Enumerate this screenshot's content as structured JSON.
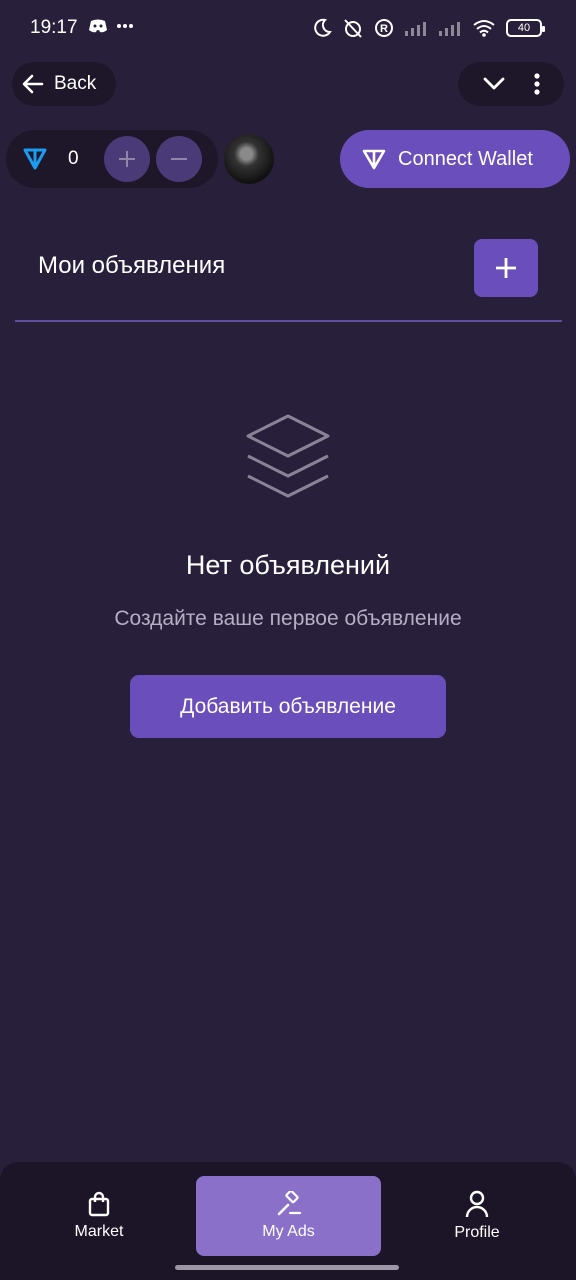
{
  "status_bar": {
    "time": "19:17",
    "battery": "40"
  },
  "top_nav": {
    "back_label": "Back"
  },
  "balance": {
    "value": "0"
  },
  "connect_wallet": {
    "label": "Connect Wallet"
  },
  "section": {
    "title": "Мои объявления"
  },
  "empty_state": {
    "title": "Нет объявлений",
    "subtitle": "Создайте ваше первое объявление",
    "button_label": "Добавить объявление"
  },
  "bottom_nav": {
    "items": [
      {
        "label": "Market",
        "icon": "shopping-bag-icon"
      },
      {
        "label": "My Ads",
        "icon": "gavel-icon",
        "active": true
      },
      {
        "label": "Profile",
        "icon": "person-icon"
      }
    ]
  },
  "colors": {
    "background": "#28203a",
    "accent": "#6a4ebb",
    "active_tab": "#8a70c9",
    "ton_blue": "#1c9cf0"
  }
}
